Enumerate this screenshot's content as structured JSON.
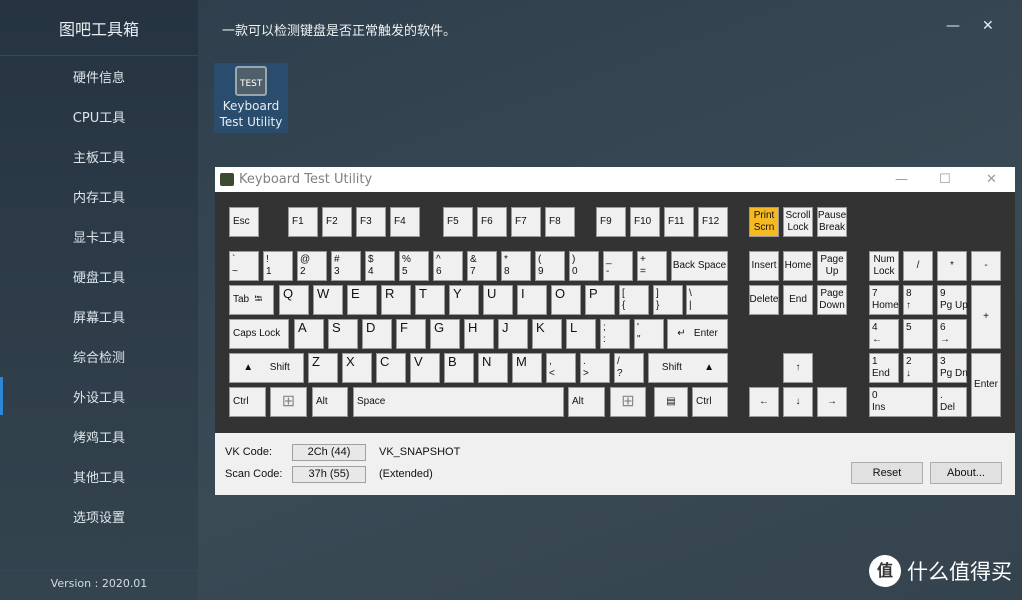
{
  "sidebar": {
    "title": "图吧工具箱",
    "items": [
      {
        "label": "硬件信息"
      },
      {
        "label": "CPU工具"
      },
      {
        "label": "主板工具"
      },
      {
        "label": "内存工具"
      },
      {
        "label": "显卡工具"
      },
      {
        "label": "硬盘工具"
      },
      {
        "label": "屏幕工具"
      },
      {
        "label": "综合检测"
      },
      {
        "label": "外设工具",
        "active": true
      },
      {
        "label": "烤鸡工具"
      },
      {
        "label": "其他工具"
      },
      {
        "label": "选项设置"
      }
    ],
    "version": "Version : 2020.01"
  },
  "header": {
    "description": "一款可以检测键盘是否正常触发的软件。",
    "minimize": "—",
    "close": "✕"
  },
  "tile": {
    "line1": "Keyboard",
    "line2": "Test Utility",
    "icon": "keyboard-test-icon",
    "icon_text": "TEST"
  },
  "kwindow": {
    "title": "Keyboard Test Utility",
    "minimize": "—",
    "maximize": "☐",
    "close": "✕",
    "highlight_color": "#f5b921",
    "keys": [
      "Esc",
      "F1",
      "F2",
      "F3",
      "F4",
      "F5",
      "F6",
      "F7",
      "F8",
      "F9",
      "F10",
      "F11",
      "F12",
      "Print\nScrn",
      "Scroll\nLock",
      "Pause\nBreak",
      "`\n~",
      "!\n1",
      "@\n2",
      "#\n3",
      "$\n4",
      "%\n5",
      "^\n6",
      "&\n7",
      "*\n8",
      "(\n9",
      ")\n0",
      "_\n-",
      "+\n=",
      "Back Space",
      "Insert",
      "Home",
      "Page\nUp",
      "Num\nLock",
      "/",
      "*",
      "-",
      "Tab  ⭾",
      "Q",
      "W",
      "E",
      "R",
      "T",
      "Y",
      "U",
      "I",
      "O",
      "P",
      "[\n{",
      "]\n}",
      "\\\n|",
      "Delete",
      "End",
      "Page\nDown",
      "7\nHome",
      "8\n↑",
      "9\nPg Up",
      "+",
      "Caps Lock",
      "A",
      "S",
      "D",
      "F",
      "G",
      "H",
      "J",
      "K",
      "L",
      ";\n:",
      "'\n\"",
      "↵   Enter",
      "4\n←",
      "5",
      "6\n→",
      "▲      Shift",
      "Z",
      "X",
      "C",
      "V",
      "B",
      "N",
      "M",
      ",\n<",
      ".\n>",
      "/\n?",
      "Shift        ▲",
      "↑",
      "1\nEnd",
      "2\n↓",
      "3\nPg Dn",
      "Enter",
      "Ctrl",
      "⊞",
      "Alt",
      "Space",
      "Alt",
      "⊞",
      "▤",
      "Ctrl",
      "←",
      "↓",
      "→",
      "0\nIns",
      ".\nDel"
    ],
    "pressed_key": "Print\nScrn",
    "vk_label": "VK Code:",
    "vk_value": "2Ch (44)",
    "vk_name": "VK_SNAPSHOT",
    "scan_label": "Scan Code:",
    "scan_value": "37h (55)",
    "scan_note": "(Extended)",
    "reset": "Reset",
    "about": "About..."
  },
  "watermark": {
    "logo": "值",
    "text": "什么值得买"
  }
}
